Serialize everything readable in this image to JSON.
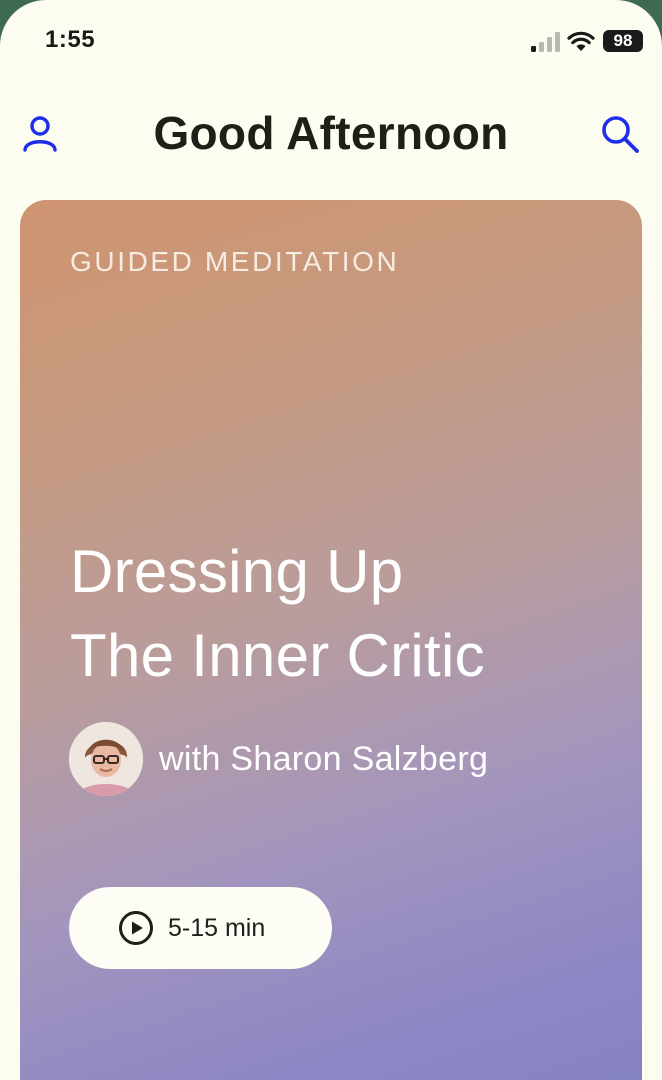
{
  "status_bar": {
    "time": "1:55",
    "battery": "98"
  },
  "header": {
    "title": "Good Afternoon",
    "profile_icon": "person-icon",
    "search_icon": "search-icon"
  },
  "card": {
    "category": "GUIDED MEDITATION",
    "title_line1": "Dressing Up",
    "title_line2": "The Inner Critic",
    "author": "with Sharon Salzberg",
    "duration": "5-15 min",
    "play_icon": "play-circle-icon"
  },
  "colors": {
    "accent": "#1f2ee8",
    "background": "#fcfcf0",
    "card_gradient_top": "#cf9470",
    "card_gradient_bottom": "#8583c3"
  }
}
